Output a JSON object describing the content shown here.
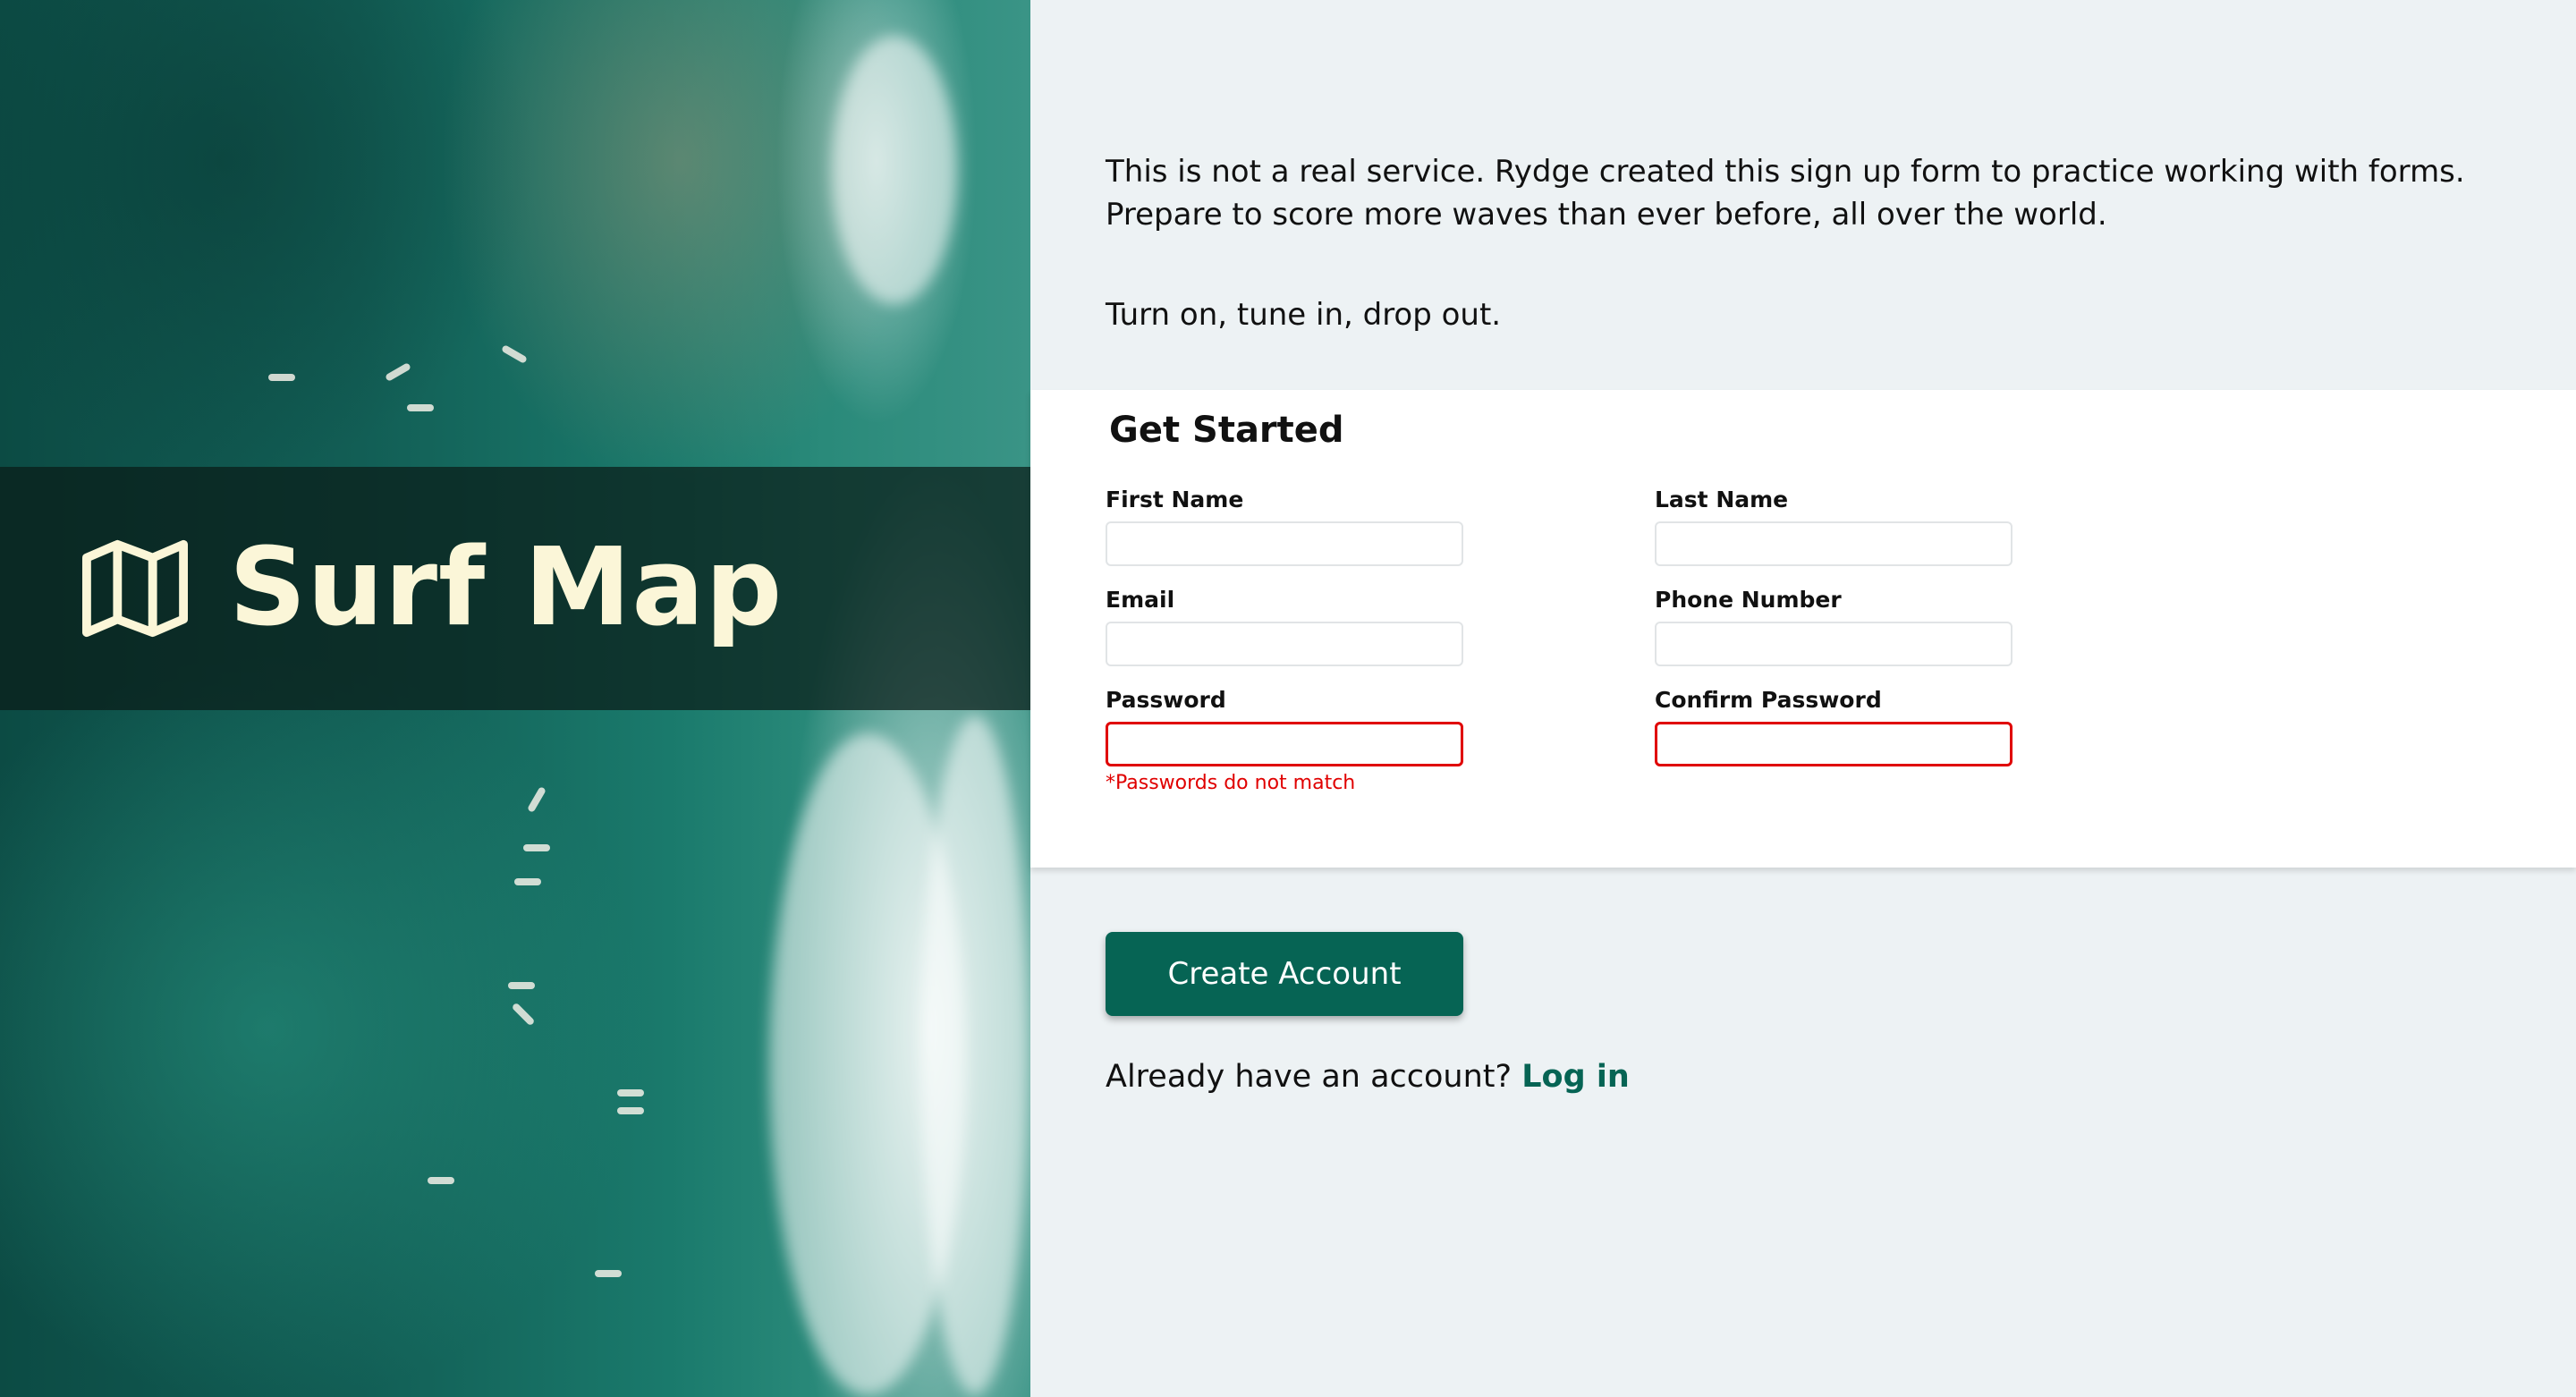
{
  "brand": {
    "title": "Surf Map",
    "icon": "map-icon"
  },
  "intro": {
    "line1": "This is not a real service. Rydge created this sign up form to practice working with forms.",
    "line2": "Prepare to score more waves than ever before, all over the world.",
    "motto": "Turn on, tune in, drop out."
  },
  "form": {
    "title": "Get Started",
    "fields": {
      "first_name": {
        "label": "First Name",
        "value": ""
      },
      "last_name": {
        "label": "Last Name",
        "value": ""
      },
      "email": {
        "label": "Email",
        "value": ""
      },
      "phone": {
        "label": "Phone Number",
        "value": ""
      },
      "password": {
        "label": "Password",
        "value": ""
      },
      "confirm_password": {
        "label": "Confirm Password",
        "value": ""
      }
    },
    "error": "*Passwords do not match"
  },
  "actions": {
    "create_label": "Create Account",
    "login_prompt": "Already have an account?",
    "login_link": "Log in"
  },
  "colors": {
    "accent": "#066454",
    "error": "#e00000",
    "page_bg": "#edf2f4",
    "brand_text": "#fbf6d8"
  }
}
